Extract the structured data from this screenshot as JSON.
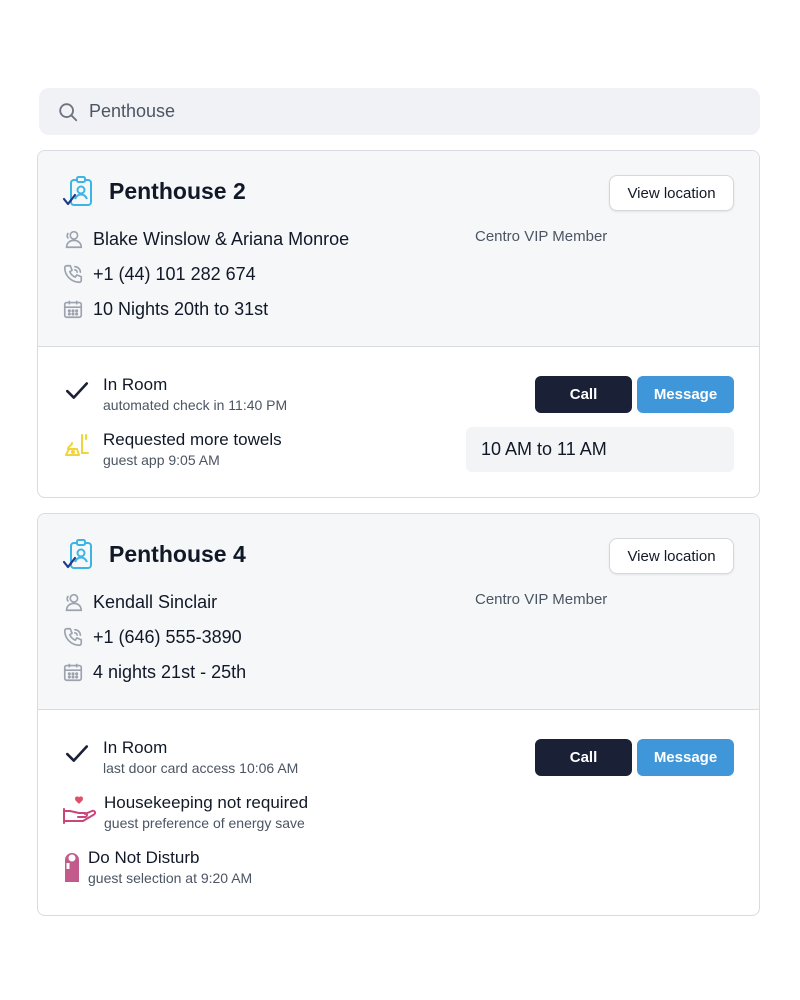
{
  "search": {
    "value": "Penthouse",
    "placeholder": "Search"
  },
  "cards": [
    {
      "title": "Penthouse 2",
      "view_label": "View location",
      "guest": "Blake Winslow & Ariana Monroe",
      "membership": "Centro VIP Member",
      "phone": "+1 (44) 101 282 674",
      "stay": "10 Nights 20th to 31st",
      "call_label": "Call",
      "message_label": "Message",
      "activities": [
        {
          "icon": "check-icon",
          "title": "In Room",
          "subtitle": "automated check in 11:40 PM"
        },
        {
          "icon": "towels-request-icon",
          "title": "Requested more towels",
          "subtitle": "guest app 9:05 AM"
        }
      ],
      "time_slot": "10 AM to 11 AM"
    },
    {
      "title": "Penthouse 4",
      "view_label": "View location",
      "guest": "Kendall Sinclair",
      "membership": "Centro VIP Member",
      "phone": "+1 (646) 555-3890",
      "stay": "4 nights 21st - 25th",
      "call_label": "Call",
      "message_label": "Message",
      "activities": [
        {
          "icon": "check-icon",
          "title": "In Room",
          "subtitle": "last door card access 10:06 AM"
        },
        {
          "icon": "heart-hand-icon",
          "title": "Housekeeping not required",
          "subtitle": "guest preference of energy save"
        },
        {
          "icon": "door-hanger-icon",
          "title": "Do Not Disturb",
          "subtitle": "guest selection at 9:20 AM"
        }
      ]
    }
  ],
  "colors": {
    "accent_blue": "#3f97d9",
    "dark_button": "#1a2035",
    "room_icon": "#3cb4e6",
    "towel_icon": "#f0d43a",
    "heart_icon": "#e0506a",
    "hanger_icon": "#c25a8c"
  }
}
